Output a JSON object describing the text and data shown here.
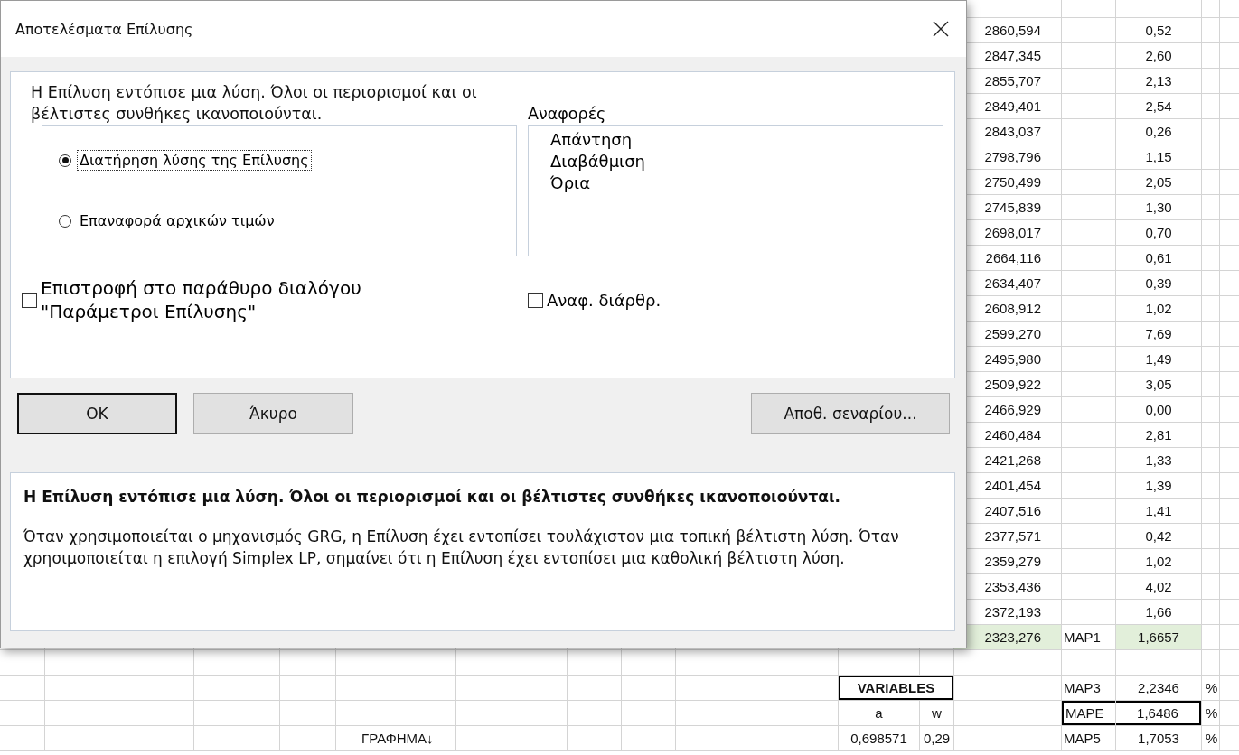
{
  "sheet": {
    "rows": [
      {
        "cells": {
          "column_n": {
            "text": "2860,594"
          },
          "column_p": {
            "text": "0,52"
          }
        }
      },
      {
        "cells": {
          "column_n": {
            "text": "2847,345"
          },
          "column_p": {
            "text": "2,60"
          }
        }
      },
      {
        "cells": {
          "column_n": {
            "text": "2855,707"
          },
          "column_p": {
            "text": "2,13"
          }
        }
      },
      {
        "cells": {
          "column_n": {
            "text": "2849,401"
          },
          "column_p": {
            "text": "2,54"
          }
        }
      },
      {
        "cells": {
          "column_n": {
            "text": "2843,037"
          },
          "column_p": {
            "text": "0,26"
          }
        }
      },
      {
        "cells": {
          "column_n": {
            "text": "2798,796"
          },
          "column_p": {
            "text": "1,15"
          }
        }
      },
      {
        "cells": {
          "column_n": {
            "text": "2750,499"
          },
          "column_p": {
            "text": "2,05"
          }
        }
      },
      {
        "cells": {
          "column_n": {
            "text": "2745,839"
          },
          "column_p": {
            "text": "1,30"
          }
        }
      },
      {
        "cells": {
          "column_n": {
            "text": "2698,017"
          },
          "column_p": {
            "text": "0,70"
          }
        }
      },
      {
        "cells": {
          "column_n": {
            "text": "2664,116"
          },
          "column_p": {
            "text": "0,61"
          }
        }
      },
      {
        "cells": {
          "column_n": {
            "text": "2634,407"
          },
          "column_p": {
            "text": "0,39"
          }
        }
      },
      {
        "cells": {
          "column_n": {
            "text": "2608,912"
          },
          "column_p": {
            "text": "1,02"
          }
        }
      },
      {
        "cells": {
          "column_n": {
            "text": "2599,270"
          },
          "column_p": {
            "text": "7,69"
          }
        }
      },
      {
        "cells": {
          "column_n": {
            "text": "2495,980"
          },
          "column_p": {
            "text": "1,49"
          }
        }
      },
      {
        "cells": {
          "column_n": {
            "text": "2509,922"
          },
          "column_p": {
            "text": "3,05"
          }
        }
      },
      {
        "cells": {
          "column_n": {
            "text": "2466,929"
          },
          "column_p": {
            "text": "0,00"
          }
        }
      },
      {
        "cells": {
          "column_n": {
            "text": "2460,484"
          },
          "column_p": {
            "text": "2,81"
          }
        }
      },
      {
        "cells": {
          "column_n": {
            "text": "2421,268"
          },
          "column_p": {
            "text": "1,33"
          }
        }
      },
      {
        "cells": {
          "column_n": {
            "text": "2401,454"
          },
          "column_p": {
            "text": "1,39"
          }
        }
      },
      {
        "cells": {
          "column_n": {
            "text": "2407,516"
          },
          "column_p": {
            "text": "1,41"
          }
        }
      },
      {
        "cells": {
          "column_n": {
            "text": "2377,571"
          },
          "column_p": {
            "text": "0,42"
          }
        }
      },
      {
        "cells": {
          "column_n": {
            "text": "2359,279"
          },
          "column_p": {
            "text": "1,02"
          }
        }
      },
      {
        "cells": {
          "column_n": {
            "text": "2353,436"
          },
          "column_p": {
            "text": "4,02"
          }
        }
      },
      {
        "cells": {
          "column_n": {
            "text": "2372,193"
          },
          "column_p": {
            "text": "1,66"
          }
        }
      },
      {
        "cells": {
          "column_n": {
            "text": "2323,276",
            "filled": true
          },
          "column_o": {
            "text": "MAP1"
          },
          "column_p": {
            "text": "1,6657",
            "filled": true
          }
        }
      },
      {
        "cells": {}
      },
      {
        "cells": {
          "column_l": {
            "text": "VARIABLES",
            "bold": true,
            "boxed": true,
            "merged_with_next": true
          },
          "column_o": {
            "text": "MAP3"
          },
          "column_p": {
            "text": "2,2346"
          },
          "column_q": {
            "text": "%"
          }
        }
      },
      {
        "cells": {
          "column_l": {
            "text": "a"
          },
          "column_m": {
            "text": "w"
          },
          "column_o": {
            "text": "MAPE",
            "boxed": true
          },
          "column_p": {
            "text": "1,6486",
            "boxed": true
          },
          "column_q": {
            "text": "%"
          }
        }
      },
      {
        "cells": {
          "column_f": {
            "text": "ΓΡΑΦΗΜΑ↓"
          },
          "column_l": {
            "text": "0,698571"
          },
          "column_m": {
            "text": "0,29"
          },
          "column_o": {
            "text": "MAP5"
          },
          "column_p": {
            "text": "1,7053"
          },
          "column_q": {
            "text": "%"
          }
        }
      }
    ]
  },
  "dialog": {
    "title": "Αποτελέσματα Επίλυσης",
    "message": "Η Επίλυση εντόπισε μια λύση. Όλοι οι περιορισμοί και οι βέλτιστες συνθήκες ικανοποιούνται.",
    "radios": [
      {
        "label": "Διατήρηση λύσης της Επίλυσης",
        "selected": true
      },
      {
        "label": "Επαναφορά αρχικών τιμών",
        "selected": false
      }
    ],
    "reports": {
      "label": "Αναφορές",
      "items": [
        "Απάντηση",
        "Διαβάθμιση",
        "Όρια"
      ]
    },
    "return_checkbox": {
      "label": "Επιστροφή στο παράθυρο διαλόγου \"Παράμετροι Επίλυσης\"",
      "checked": false
    },
    "outline_checkbox": {
      "label": "Αναφ. διάρθρ.",
      "checked": false
    },
    "buttons": [
      {
        "label": "OK",
        "default": true
      },
      {
        "label": "Άκυρο",
        "default": false
      }
    ],
    "save_button": "Αποθ. σεναρίου...",
    "info": {
      "heading": "Η Επίλυση εντόπισε μια λύση. Όλοι οι περιορισμοί και οι βέλτιστες συνθήκες ικανοποιούνται.",
      "body": "Όταν χρησιμοποιείται ο μηχανισμός GRG, η Επίλυση έχει εντοπίσει τουλάχιστον μια τοπική βέλτιστη λύση. Όταν χρησιμοποιείται η επιλογή Simplex LP, σημαίνει ότι η Επίλυση έχει εντοπίσει μια καθολική βέλτιστη λύση."
    }
  }
}
